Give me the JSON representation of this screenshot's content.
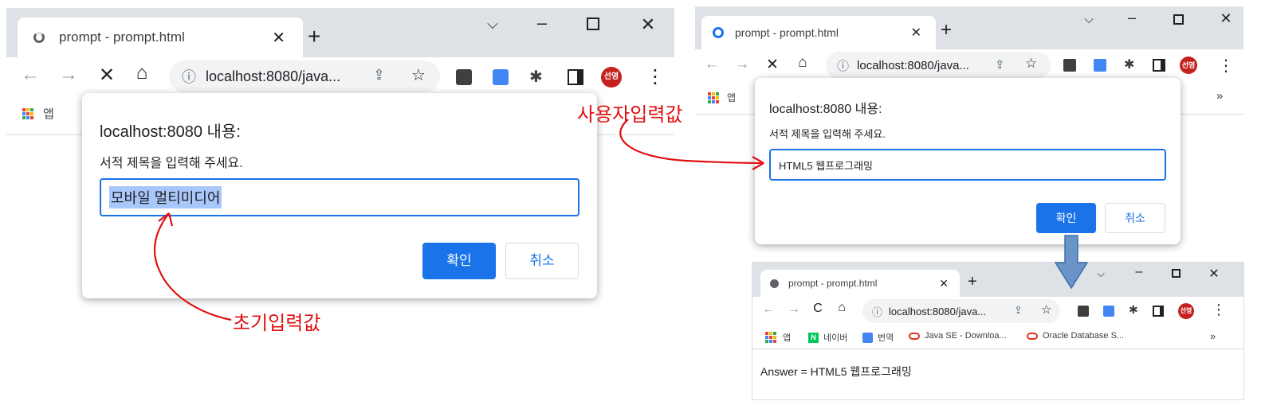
{
  "browser_left": {
    "tab_title": "prompt - prompt.html",
    "url": "localhost:8080/java...",
    "bookmarks": {
      "apps_label": "앱"
    },
    "avatar_text": "선영",
    "dialog": {
      "heading": "localhost:8080 내용:",
      "message": "서적 제목을 입력해 주세요.",
      "input_value": "모바일 멀티미디어",
      "ok_label": "확인",
      "cancel_label": "취소"
    }
  },
  "browser_right_top": {
    "tab_title": "prompt - prompt.html",
    "url": "localhost:8080/java...",
    "bookmarks": {
      "apps_label": "앱",
      "more": "»"
    },
    "avatar_text": "선영",
    "dialog": {
      "heading": "localhost:8080 내용:",
      "message": "서적 제목을 입력해 주세요.",
      "input_value": "HTML5 웹프로그래밍",
      "ok_label": "확인",
      "cancel_label": "취소"
    }
  },
  "browser_right_bottom": {
    "tab_title": "prompt - prompt.html",
    "url": "localhost:8080/java...",
    "avatar_text": "선영",
    "bookmarks": {
      "apps_label": "앱",
      "items": [
        "네이버",
        "번역",
        "Java SE - Downloa...",
        "Oracle Database S..."
      ],
      "more": "»"
    },
    "page_text": "Answer = HTML5 웹프로그래밍"
  },
  "annotations": {
    "user_input": "사용자입력값",
    "initial_value": "초기입력값"
  },
  "colors": {
    "accent": "#1a73e8",
    "annotation": "#e01010",
    "tabstrip": "#dee1e6",
    "arrow_fill": "#6a93c9"
  }
}
